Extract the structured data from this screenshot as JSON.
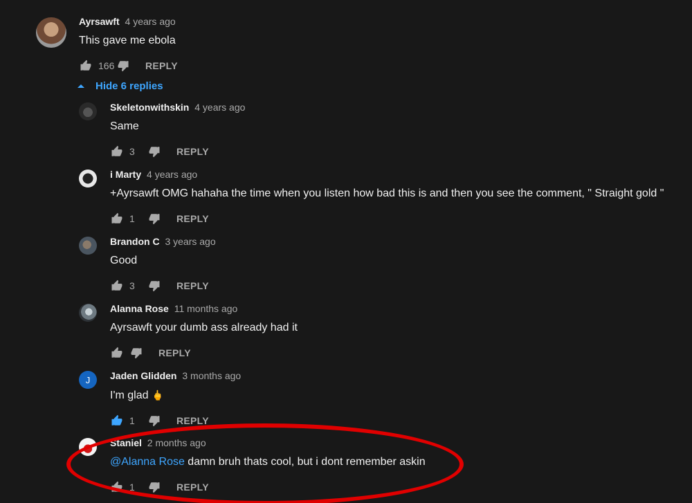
{
  "top_comment": {
    "author": "Ayrsawft",
    "time": "4 years ago",
    "text": "This gave me ebola",
    "likes": "166",
    "reply_label": "REPLY"
  },
  "toggle_label": "Hide 6 replies",
  "replies": [
    {
      "author": "Skeletonwithskin",
      "time": "4 years ago",
      "text": "Same",
      "likes": "3",
      "reply_label": "REPLY"
    },
    {
      "author": "i Marty",
      "time": "4 years ago",
      "text": "+Ayrsawft OMG hahaha the time when you listen how bad this is and then you see the comment, \" Straight gold \"",
      "likes": "1",
      "reply_label": "REPLY"
    },
    {
      "author": "Brandon C",
      "time": "3 years ago",
      "text": "Good",
      "likes": "3",
      "reply_label": "REPLY"
    },
    {
      "author": "Alanna Rose",
      "time": "11 months ago",
      "text": "Ayrsawft your dumb ass already had it",
      "likes": "",
      "reply_label": "REPLY"
    },
    {
      "author": "Jaden Glidden",
      "time": "3 months ago",
      "text": "I'm glad",
      "emoji": "🖕",
      "likes": "1",
      "reply_label": "REPLY",
      "avatar_letter": "J",
      "liked": true
    },
    {
      "author": "Staniel",
      "time": "2 months ago",
      "mention": "@Alanna Rose",
      "text": " damn bruh thats cool, but i dont remember askin",
      "likes": "1",
      "reply_label": "REPLY"
    }
  ],
  "colors": {
    "background": "#181818",
    "link": "#3ea6ff",
    "highlight": "#e00000"
  }
}
